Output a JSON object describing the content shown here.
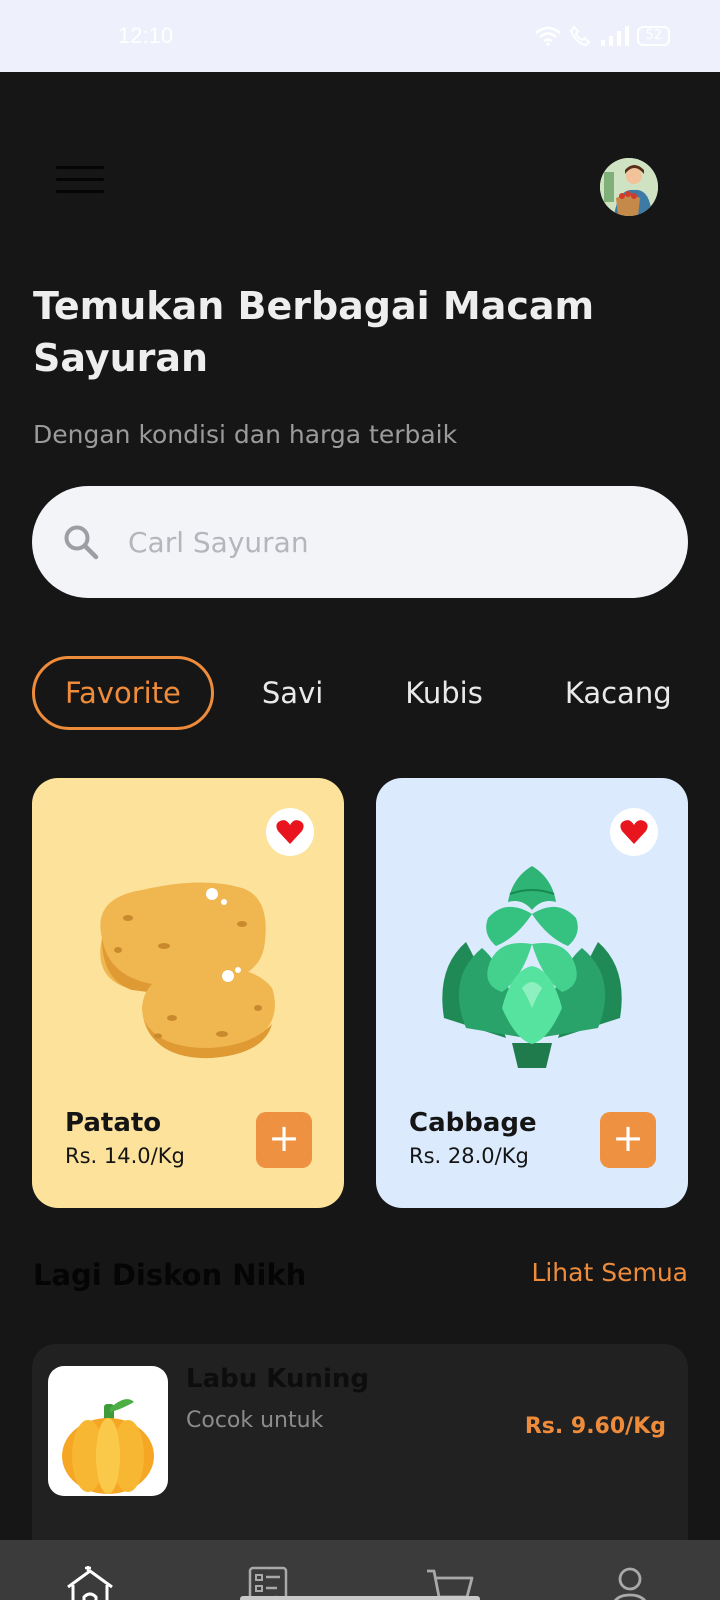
{
  "status": {
    "time": "12:10",
    "battery": "52"
  },
  "header": {
    "headline": "Temukan Berbagai Macam Sayuran",
    "subline": "Dengan kondisi dan harga terbaik"
  },
  "search": {
    "placeholder": "Carl Sayuran"
  },
  "categories": [
    {
      "label": "Favorite",
      "active": true
    },
    {
      "label": "Savi",
      "active": false
    },
    {
      "label": "Kubis",
      "active": false
    },
    {
      "label": "Kacang",
      "active": false
    }
  ],
  "products": [
    {
      "name": "Patato",
      "price": "Rs. 14.0/Kg",
      "favorite": true,
      "bg_color": "#fde29b"
    },
    {
      "name": "Cabbage",
      "price": "Rs. 28.0/Kg",
      "favorite": true,
      "bg_color": "#dbeafc"
    }
  ],
  "discount_section": {
    "title": "Lagi Diskon Nikh",
    "see_all": "Lihat Semua",
    "items": [
      {
        "name": "Labu Kuning",
        "desc": "Cocok untuk",
        "price": "Rs. 9.60/Kg"
      }
    ]
  },
  "nav": [
    {
      "icon": "home-icon",
      "active": true
    },
    {
      "icon": "orders-icon",
      "active": false
    },
    {
      "icon": "cart-icon",
      "active": false
    },
    {
      "icon": "profile-icon",
      "active": false
    }
  ],
  "colors": {
    "accent": "#ee8c3b",
    "background": "#161616",
    "heart": "#e8141e"
  }
}
